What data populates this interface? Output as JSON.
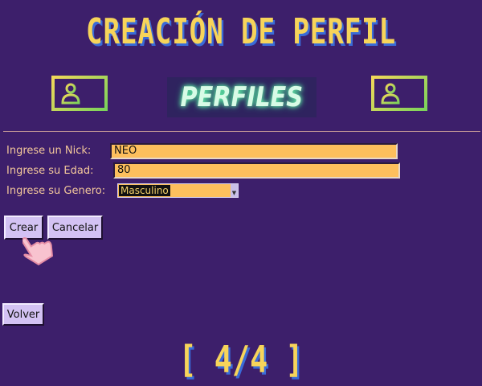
{
  "header": {
    "title": "CREACIÓN DE PERFIL",
    "banner": "PERFILES"
  },
  "icons": {
    "left": "id-card-icon",
    "right": "id-card-icon"
  },
  "form": {
    "nick": {
      "label": "Ingrese un Nick:",
      "value": "NEO"
    },
    "age": {
      "label": "Ingrese su Edad:",
      "value": "80"
    },
    "gender": {
      "label": "Ingrese su Genero:",
      "selected": "Masculino"
    }
  },
  "buttons": {
    "create": "Crear",
    "cancel": "Cancelar",
    "back": "Volver"
  },
  "footer": {
    "page_counter": "[ 4/4 ]"
  },
  "colors": {
    "background": "#3d1f6b",
    "title": "#f7d45a",
    "input_bg": "#fdbf5d",
    "button_bg": "#d3c2f3",
    "label": "#f4c89b"
  }
}
